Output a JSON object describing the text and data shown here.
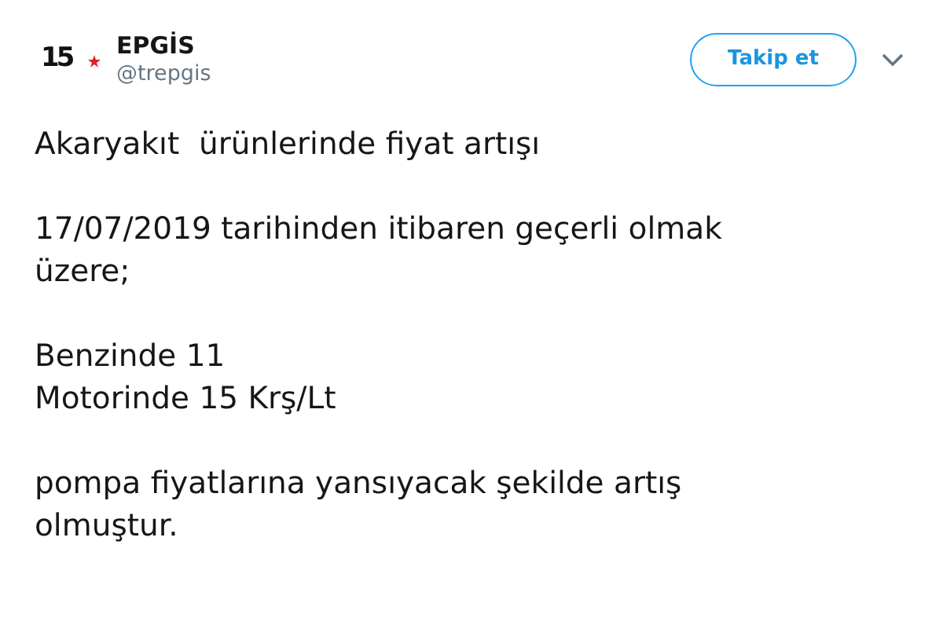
{
  "author": {
    "logo_text": "15",
    "name": "EPGİS",
    "handle": "@trepgis"
  },
  "follow_button": {
    "label": "Takip et"
  },
  "paragraphs": [
    [
      "Akaryakıt  ürünlerinde fiyat artışı"
    ],
    [
      "17/07/2019 tarihinden itibaren geçerli olmak",
      "üzere;"
    ],
    [
      "Benzinde 11",
      "Motorinde 15 Krş/Lt"
    ],
    [
      "pompa fiyatlarına yansıyacak şekilde artış",
      "olmuştur."
    ]
  ]
}
